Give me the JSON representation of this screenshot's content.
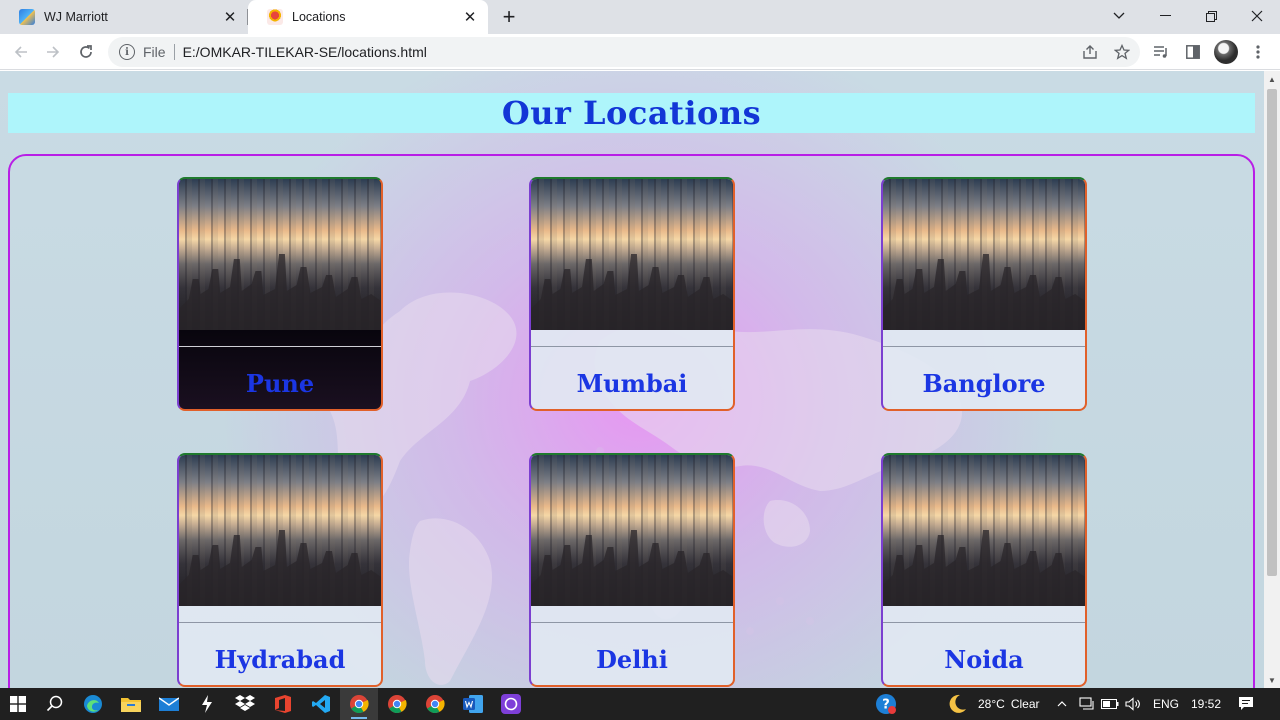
{
  "browser": {
    "tabs": [
      {
        "title": "WJ Marriott",
        "active": false
      },
      {
        "title": "Locations",
        "active": true
      }
    ],
    "new_tab_label": "+",
    "address": {
      "scheme_label": "File",
      "url": "E:/OMKAR-TILEKAR-SE/locations.html"
    }
  },
  "page": {
    "title": "Our Locations",
    "locations": [
      {
        "name": "Pune"
      },
      {
        "name": "Mumbai"
      },
      {
        "name": "Banglore"
      },
      {
        "name": "Hydrabad"
      },
      {
        "name": "Delhi"
      },
      {
        "name": "Noida"
      }
    ]
  },
  "taskbar": {
    "weather": {
      "temp": "28°C",
      "condition": "Clear"
    },
    "language": "ENG",
    "time": "19:52"
  },
  "colors": {
    "title": "#1236d6",
    "header_bg": "#aef5fb",
    "frame_border": "#b81ee6",
    "card_name": "#1b36e3"
  }
}
